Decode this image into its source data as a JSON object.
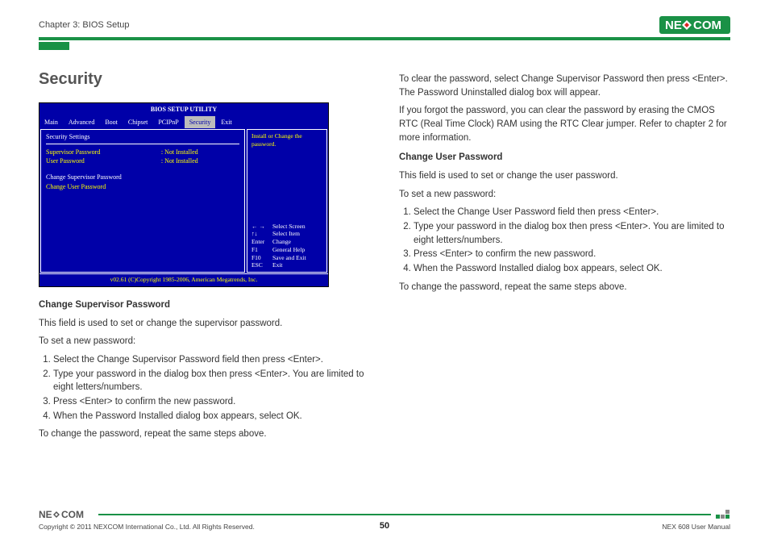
{
  "header": {
    "chapter": "Chapter 3: BIOS Setup"
  },
  "logo": {
    "brand_left": "NE",
    "brand_right": "COM"
  },
  "section_title": "Security",
  "bios": {
    "title": "BIOS SETUP UTILITY",
    "tabs": [
      "Main",
      "Advanced",
      "Boot",
      "Chipset",
      "PCIPnP",
      "Security",
      "Exit"
    ],
    "settings_head": "Security Settings",
    "rows": [
      {
        "label": "Supervisor Password",
        "value": ": Not Installed"
      },
      {
        "label": "User Password",
        "value": ": Not Installed"
      }
    ],
    "change_sup": "Change Supervisor Password",
    "change_user": "Change User Password",
    "hint": "Install or Change the password.",
    "keys": [
      {
        "k": "← →",
        "v": "Select Screen"
      },
      {
        "k": "↑↓",
        "v": "Select Item"
      },
      {
        "k": "Enter",
        "v": "Change"
      },
      {
        "k": "F1",
        "v": "General Help"
      },
      {
        "k": "F10",
        "v": "Save and Exit"
      },
      {
        "k": "ESC",
        "v": "Exit"
      }
    ],
    "copyright": "v02.61 (C)Copyright 1985-2006, American Megatrends, Inc."
  },
  "left": {
    "h1": "Change Supervisor Password",
    "p1": "This field is used to set or change the supervisor password.",
    "p2": "To set a new password:",
    "ol": [
      "Select the Change Supervisor Password field then press <Enter>.",
      "Type your password in the dialog box then press <Enter>. You are limited to eight letters/numbers.",
      "Press <Enter> to confirm the new password.",
      "When the Password Installed dialog box appears, select OK."
    ],
    "p3": "To change the password, repeat the same steps above."
  },
  "right": {
    "p0a": "To clear the password, select Change Supervisor Password then press <Enter>. The Password Uninstalled dialog box will appear.",
    "p0b": "If you forgot the password, you can clear the password by erasing the CMOS RTC (Real Time Clock) RAM using the RTC Clear jumper. Refer to chapter 2 for more information.",
    "h1": "Change User Password",
    "p1": "This field is used to set or change the user password.",
    "p2": "To set a new password:",
    "ol": [
      "Select the Change User Password field then press <Enter>.",
      "Type your password in the dialog box then press <Enter>. You are limited to eight letters/numbers.",
      "Press <Enter> to confirm the new password.",
      "When the Password Installed dialog box appears, select OK."
    ],
    "p3": "To change the password, repeat the same steps above."
  },
  "footer": {
    "copyright": "Copyright © 2011 NEXCOM International Co., Ltd. All Rights Reserved.",
    "page": "50",
    "manual": "NEX 608 User Manual"
  }
}
